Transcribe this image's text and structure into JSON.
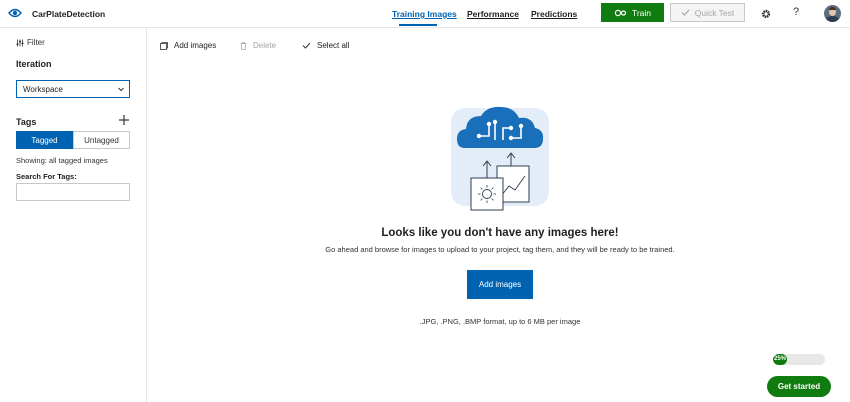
{
  "header": {
    "app_title": "CarPlateDetection",
    "tabs": [
      {
        "label": "Training Images",
        "active": true
      },
      {
        "label": "Performance",
        "active": false
      },
      {
        "label": "Predictions",
        "active": false
      }
    ],
    "train_label": "Train",
    "quick_test_label": "Quick Test",
    "help_label": "?",
    "brand_color": "#0063b1",
    "train_color": "#107c10"
  },
  "sidebar": {
    "filter_label": "Filter",
    "iteration_title": "Iteration",
    "iteration_selected": "Workspace",
    "tags_title": "Tags",
    "tag_tabs": [
      {
        "label": "Tagged",
        "selected": true
      },
      {
        "label": "Untagged",
        "selected": false
      }
    ],
    "showing_text": "Showing: all tagged images",
    "search_label": "Search For Tags:",
    "search_value": ""
  },
  "toolbar": {
    "add_images_label": "Add images",
    "delete_label": "Delete",
    "select_all_label": "Select all"
  },
  "empty_state": {
    "title": "Looks like you don't have any images here!",
    "description": "Go ahead and browse for images to upload to your project, tag them, and they will be ready to be trained.",
    "add_button_label": "Add images",
    "formats_text": ".JPG, .PNG, .BMP format, up to 6 MB per image"
  },
  "onboarding": {
    "progress_text": "25%",
    "progress_value": 0.25,
    "get_started_label": "Get started"
  }
}
